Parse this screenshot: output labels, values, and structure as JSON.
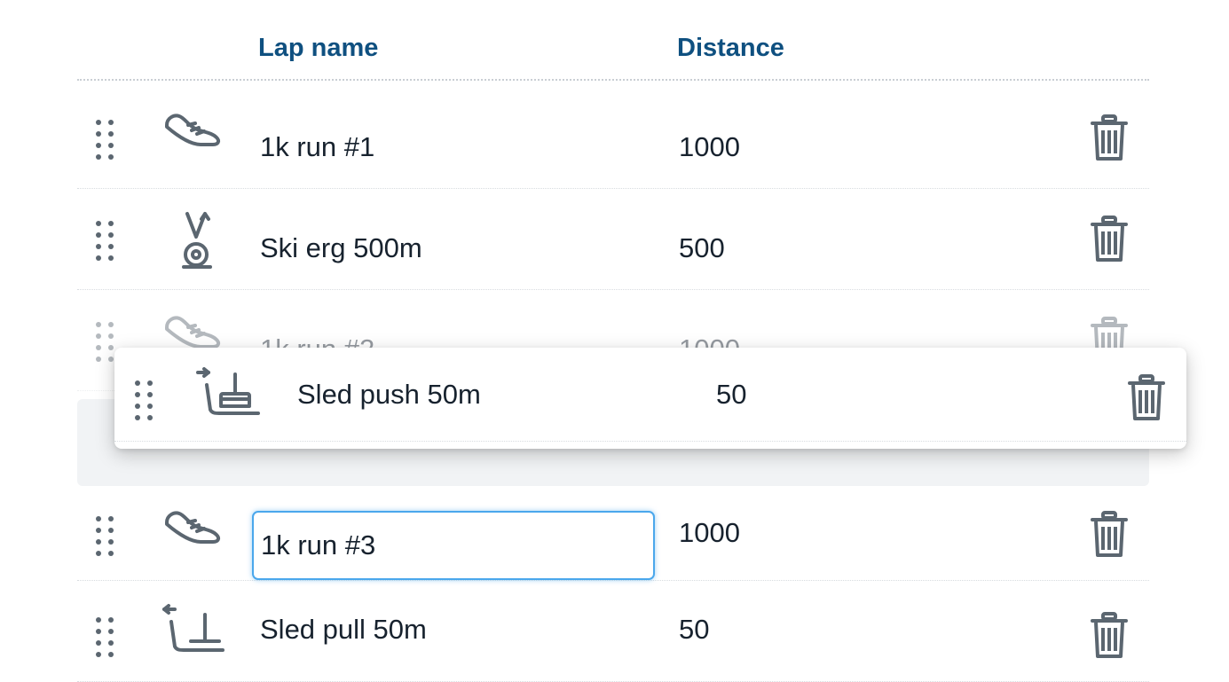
{
  "columns": {
    "lap_name": "Lap name",
    "distance": "Distance"
  },
  "rows": [
    {
      "name": "1k run #1",
      "distance": "1000",
      "icon": "running-shoe-icon"
    },
    {
      "name": "Ski erg 500m",
      "distance": "500",
      "icon": "ski-erg-icon"
    },
    {
      "name": "1k run #2",
      "distance": "1000",
      "icon": "running-shoe-icon"
    },
    {
      "name": "1k run #3",
      "distance": "1000",
      "icon": "running-shoe-icon"
    },
    {
      "name": "Sled pull 50m",
      "distance": "50",
      "icon": "sled-pull-icon"
    }
  ],
  "dragging": {
    "name": "Sled push 50m",
    "distance": "50",
    "icon": "sled-push-icon"
  },
  "colors": {
    "header": "#0f5080",
    "icon": "#5b6670",
    "focus": "#4aa7ec"
  }
}
